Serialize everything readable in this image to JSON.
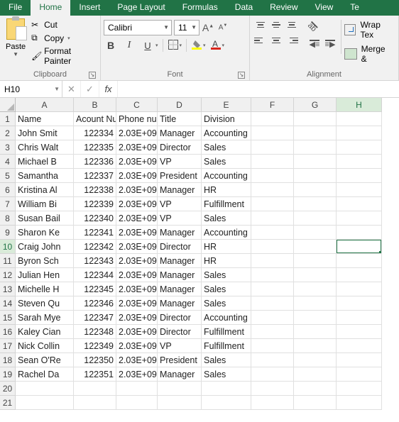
{
  "tabs": [
    "File",
    "Home",
    "Insert",
    "Page Layout",
    "Formulas",
    "Data",
    "Review",
    "View",
    "Te"
  ],
  "active_tab": "Home",
  "clipboard": {
    "paste": "Paste",
    "cut": "Cut",
    "copy": "Copy",
    "format_painter": "Format Painter",
    "group_label": "Clipboard"
  },
  "font": {
    "name": "Calibri",
    "size": "11",
    "group_label": "Font"
  },
  "alignment": {
    "wrap": "Wrap Tex",
    "merge": "Merge &",
    "group_label": "Alignment"
  },
  "namebox": "H10",
  "formula": "",
  "columns": [
    "A",
    "B",
    "C",
    "D",
    "E",
    "F",
    "G",
    "H"
  ],
  "headers": {
    "A": "Name",
    "B": "Acount Nu",
    "C": "Phone num",
    "D": "Title",
    "E": "Division"
  },
  "rows": [
    {
      "n": 1,
      "A": "Name",
      "B": "Acount Nu",
      "C": "Phone num",
      "D": "Title",
      "E": "Division",
      "numB": false
    },
    {
      "n": 2,
      "A": "John Smit",
      "B": "122334",
      "C": "2.03E+09",
      "D": "Manager",
      "E": "Accounting",
      "numB": true
    },
    {
      "n": 3,
      "A": "Chris Walt",
      "B": "122335",
      "C": "2.03E+09",
      "D": "Director",
      "E": "Sales",
      "numB": true
    },
    {
      "n": 4,
      "A": "Michael B",
      "B": "122336",
      "C": "2.03E+09",
      "D": "VP",
      "E": "Sales",
      "numB": true
    },
    {
      "n": 5,
      "A": "Samantha",
      "B": "122337",
      "C": "2.03E+09",
      "D": "President",
      "E": "Accounting",
      "numB": true
    },
    {
      "n": 6,
      "A": "Kristina Al",
      "B": "122338",
      "C": "2.03E+09",
      "D": "Manager",
      "E": "HR",
      "numB": true
    },
    {
      "n": 7,
      "A": "William Bi",
      "B": "122339",
      "C": "2.03E+09",
      "D": "VP",
      "E": "Fulfillment",
      "numB": true
    },
    {
      "n": 8,
      "A": "Susan Bail",
      "B": "122340",
      "C": "2.03E+09",
      "D": "VP",
      "E": "Sales",
      "numB": true
    },
    {
      "n": 9,
      "A": "Sharon Ke",
      "B": "122341",
      "C": "2.03E+09",
      "D": "Manager",
      "E": "Accounting",
      "numB": true
    },
    {
      "n": 10,
      "A": "Craig John",
      "B": "122342",
      "C": "2.03E+09",
      "D": "Director",
      "E": "HR",
      "numB": true
    },
    {
      "n": 11,
      "A": "Byron Sch",
      "B": "122343",
      "C": "2.03E+09",
      "D": "Manager",
      "E": "HR",
      "numB": true
    },
    {
      "n": 12,
      "A": "Julian Hen",
      "B": "122344",
      "C": "2.03E+09",
      "D": "Manager",
      "E": "Sales",
      "numB": true
    },
    {
      "n": 13,
      "A": "Michelle H",
      "B": "122345",
      "C": "2.03E+09",
      "D": "Manager",
      "E": "Sales",
      "numB": true
    },
    {
      "n": 14,
      "A": "Steven Qu",
      "B": "122346",
      "C": "2.03E+09",
      "D": "Manager",
      "E": "Sales",
      "numB": true
    },
    {
      "n": 15,
      "A": "Sarah Mye",
      "B": "122347",
      "C": "2.03E+09",
      "D": "Director",
      "E": "Accounting",
      "numB": true
    },
    {
      "n": 16,
      "A": "Kaley Cian",
      "B": "122348",
      "C": "2.03E+09",
      "D": "Director",
      "E": "Fulfillment",
      "numB": true
    },
    {
      "n": 17,
      "A": "Nick Collin",
      "B": "122349",
      "C": "2.03E+09",
      "D": "VP",
      "E": "Fulfillment",
      "numB": true
    },
    {
      "n": 18,
      "A": "Sean O'Re",
      "B": "122350",
      "C": "2.03E+09",
      "D": "President",
      "E": "Sales",
      "numB": true
    },
    {
      "n": 19,
      "A": "Rachel Da",
      "B": "122351",
      "C": "2.03E+09",
      "D": "Manager",
      "E": "Sales",
      "numB": true
    },
    {
      "n": 20,
      "A": "",
      "B": "",
      "C": "",
      "D": "",
      "E": "",
      "numB": false
    },
    {
      "n": 21,
      "A": "",
      "B": "",
      "C": "",
      "D": "",
      "E": "",
      "numB": false
    }
  ],
  "selected": {
    "row": 10,
    "col": "H"
  }
}
